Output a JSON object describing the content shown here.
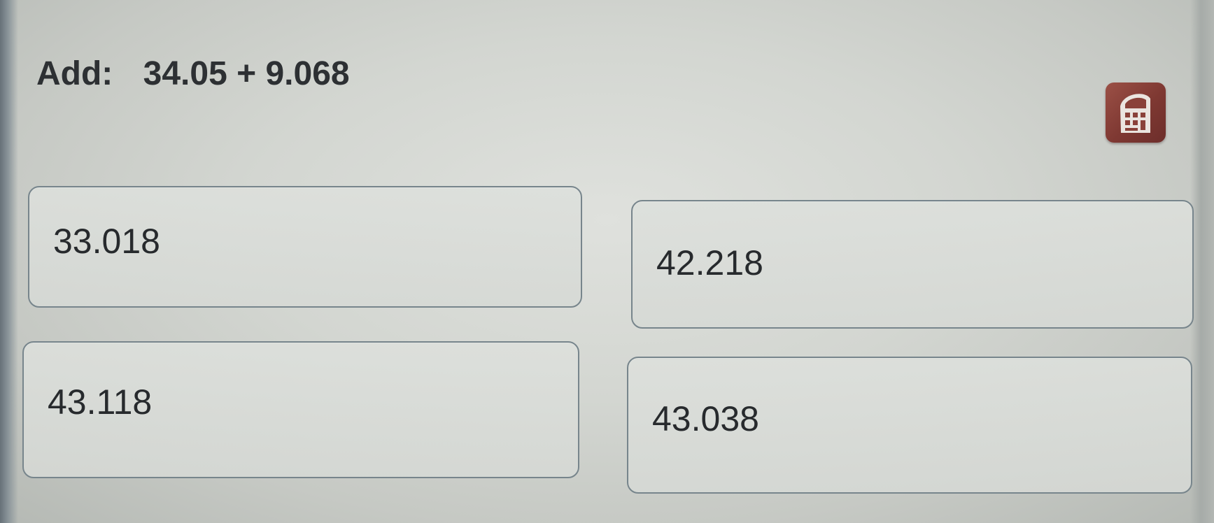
{
  "question": {
    "label": "Add:",
    "expression": "34.05 + 9.068"
  },
  "toolbar": {
    "calculator_icon": "calculator-icon"
  },
  "answer_choices": [
    "33.018",
    "42.218",
    "43.118",
    "43.038"
  ],
  "colors": {
    "background": "#d3d6d1",
    "choice_border": "#77858c",
    "text": "#272a2d",
    "calculator_icon": "#8a4139"
  }
}
